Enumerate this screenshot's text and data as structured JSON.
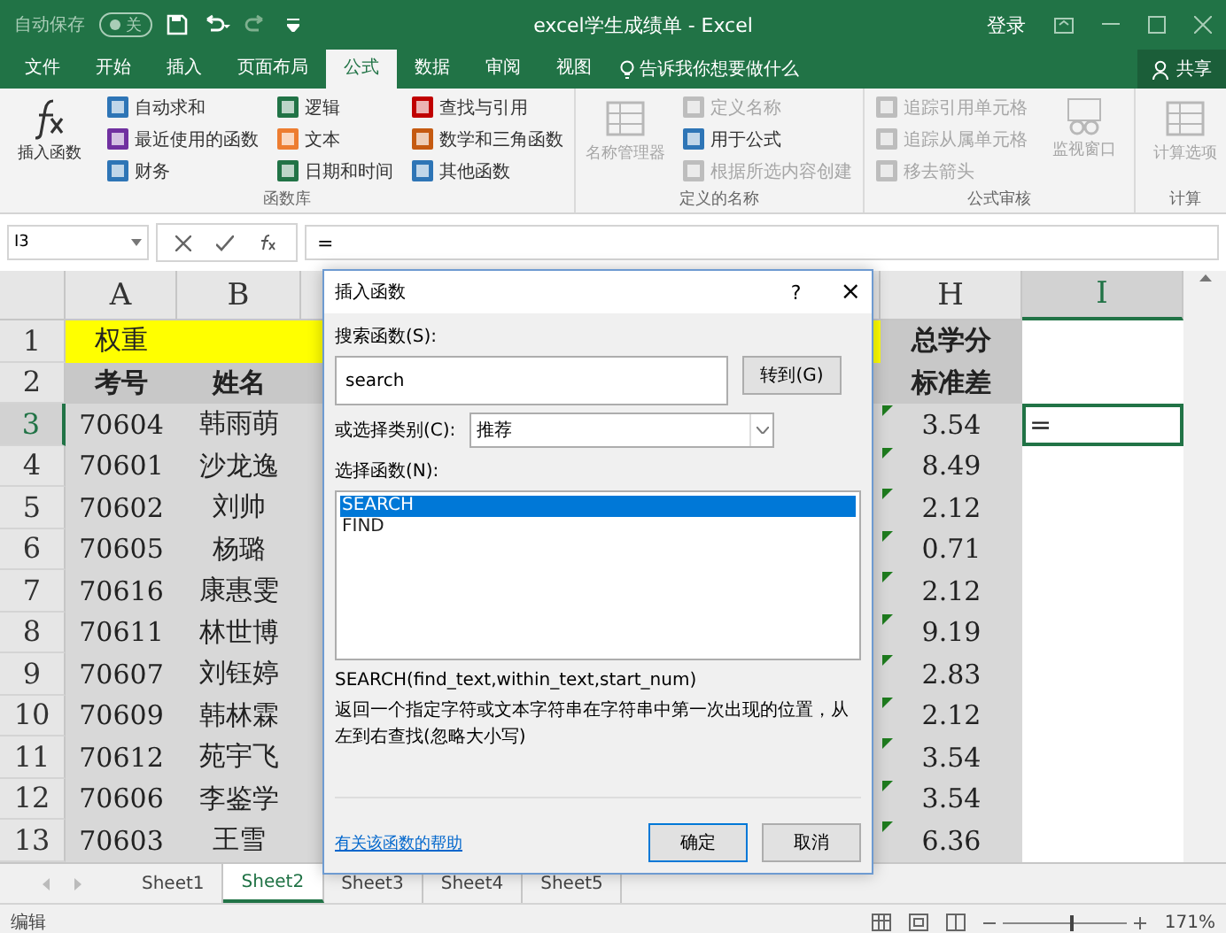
{
  "title_bar": {
    "autosave": {
      "label": "自动保存",
      "state_text": "关",
      "on": false
    },
    "title": "excel学生成绩单  -  Excel",
    "sign_in": "登录"
  },
  "tabs": [
    {
      "label": "文件",
      "selected": false
    },
    {
      "label": "开始",
      "selected": false
    },
    {
      "label": "插入",
      "selected": false
    },
    {
      "label": "页面布局",
      "selected": false
    },
    {
      "label": "公式",
      "selected": true
    },
    {
      "label": "数据",
      "selected": false
    },
    {
      "label": "审阅",
      "selected": false
    },
    {
      "label": "视图",
      "selected": false
    }
  ],
  "tell_me": "告诉我你想要做什么",
  "share": "共享",
  "ribbon": [
    {
      "label": "函数库",
      "big": [
        {
          "label": "插入函数",
          "disabled": false
        }
      ],
      "columns": [
        [
          {
            "label": "自动求和",
            "disabled": false
          },
          {
            "label": "最近使用的函数",
            "disabled": false
          },
          {
            "label": "财务",
            "disabled": false
          }
        ],
        [
          {
            "label": "逻辑",
            "disabled": false
          },
          {
            "label": "文本",
            "disabled": false
          },
          {
            "label": "日期和时间",
            "disabled": false
          }
        ],
        [
          {
            "label": "查找与引用",
            "disabled": false
          },
          {
            "label": "数学和三角函数",
            "disabled": false
          },
          {
            "label": "其他函数",
            "disabled": false
          }
        ]
      ]
    },
    {
      "label": "定义的名称",
      "big": [
        {
          "label": "名称管理器",
          "disabled": true
        }
      ],
      "columns": [
        [
          {
            "label": "定义名称",
            "disabled": true
          },
          {
            "label": "用于公式",
            "disabled": false
          },
          {
            "label": "根据所选内容创建",
            "disabled": true
          }
        ]
      ]
    },
    {
      "label": "公式审核",
      "columns": [
        [
          {
            "label": "追踪引用单元格",
            "disabled": true
          },
          {
            "label": "追踪从属单元格",
            "disabled": true
          },
          {
            "label": "移去箭头",
            "disabled": true
          }
        ]
      ],
      "after": [
        {
          "label": "监视窗口",
          "disabled": true
        }
      ]
    },
    {
      "label": "计算",
      "big": [
        {
          "label": "计算选项",
          "disabled": true
        }
      ]
    }
  ],
  "formula_bar": {
    "name_box": "I3",
    "formula": "="
  },
  "columns": [
    {
      "label": "A",
      "selected": false
    },
    {
      "label": "B",
      "selected": false
    },
    {
      "label": "H",
      "selected": false
    },
    {
      "label": "I",
      "selected": true
    }
  ],
  "rows": [
    {
      "number": "1",
      "a": "权重",
      "b": "",
      "h": "总学分",
      "i": "",
      "selected": false,
      "kind": "weight",
      "error_flag": false
    },
    {
      "number": "2",
      "a": "考号",
      "b": "姓名",
      "h": "标准差",
      "i": "",
      "selected": false,
      "kind": "header",
      "error_flag": false
    },
    {
      "number": "3",
      "a": "70604",
      "b": "韩雨萌",
      "h": "3.54",
      "i": "=",
      "selected": true,
      "kind": "data",
      "error_flag": true
    },
    {
      "number": "4",
      "a": "70601",
      "b": "沙龙逸",
      "h": "8.49",
      "i": "",
      "selected": false,
      "kind": "data",
      "error_flag": true
    },
    {
      "number": "5",
      "a": "70602",
      "b": "刘帅",
      "h": "2.12",
      "i": "",
      "selected": false,
      "kind": "data",
      "error_flag": true
    },
    {
      "number": "6",
      "a": "70605",
      "b": "杨璐",
      "h": "0.71",
      "i": "",
      "selected": false,
      "kind": "data",
      "error_flag": true
    },
    {
      "number": "7",
      "a": "70616",
      "b": "康惠雯",
      "h": "2.12",
      "i": "",
      "selected": false,
      "kind": "data",
      "error_flag": true
    },
    {
      "number": "8",
      "a": "70611",
      "b": "林世博",
      "h": "9.19",
      "i": "",
      "selected": false,
      "kind": "data",
      "error_flag": true
    },
    {
      "number": "9",
      "a": "70607",
      "b": "刘钰婷",
      "h": "2.83",
      "i": "",
      "selected": false,
      "kind": "data",
      "error_flag": true
    },
    {
      "number": "10",
      "a": "70609",
      "b": "韩林霖",
      "h": "2.12",
      "i": "",
      "selected": false,
      "kind": "data",
      "error_flag": true
    },
    {
      "number": "11",
      "a": "70612",
      "b": "苑宇飞",
      "h": "3.54",
      "i": "",
      "selected": false,
      "kind": "data",
      "error_flag": true
    },
    {
      "number": "12",
      "a": "70606",
      "b": "李鉴学",
      "h": "3.54",
      "i": "",
      "selected": false,
      "kind": "data",
      "error_flag": true
    },
    {
      "number": "13",
      "a": "70603",
      "b": "王雪",
      "h": "6.36",
      "i": "",
      "selected": false,
      "kind": "data",
      "error_flag": true
    }
  ],
  "dialog": {
    "title": "插入函数",
    "help": "?",
    "close": "×",
    "search_label": "搜索函数(S):",
    "search_value": "search",
    "go_button": "转到(G)",
    "category_label": "或选择类别(C):",
    "category_value": "推荐",
    "list_label": "选择函数(N):",
    "functions": [
      {
        "label": "SEARCH",
        "selected": true
      },
      {
        "label": "FIND",
        "selected": false
      }
    ],
    "signature": "SEARCH(find_text,within_text,start_num)",
    "description": "返回一个指定字符或文本字符串在字符串中第一次出现的位置，从左到右查找(忽略大小写)",
    "help_link": "有关该函数的帮助",
    "ok": "确定",
    "cancel": "取消"
  },
  "sheets": [
    {
      "label": "Sheet1",
      "selected": false
    },
    {
      "label": "Sheet2",
      "selected": true
    },
    {
      "label": "Sheet3",
      "selected": false
    },
    {
      "label": "Sheet4",
      "selected": false
    },
    {
      "label": "Sheet5",
      "selected": false
    }
  ],
  "status_bar": {
    "mode": "编辑",
    "zoom": "171%",
    "zoom_slider": {
      "level": 0.55
    }
  }
}
